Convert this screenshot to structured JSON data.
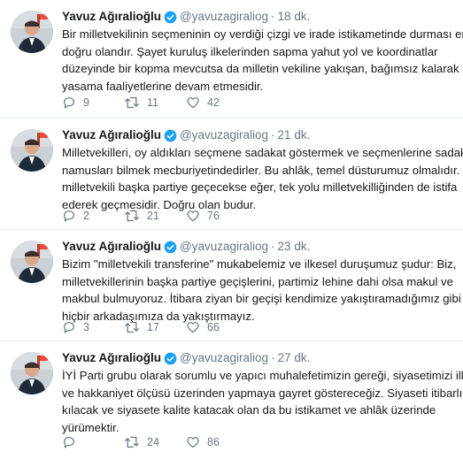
{
  "colors": {
    "accent": "#1da1f2",
    "muted": "#657786",
    "text": "#14171a",
    "divider": "#e6ecf0"
  },
  "icons": {
    "verified": "verified-badge-icon",
    "reply": "reply-icon",
    "retweet": "retweet-icon",
    "like": "heart-icon"
  },
  "tweets": [
    {
      "name": "Yavuz Ağıralioğlu",
      "handle": "@yavuzagiraliog",
      "dot": "·",
      "time": "18 dk.",
      "lines": [
        "Bir milletvekilinin seçmeninin oy verdiği çizgi ve irade istikametinde durması en",
        "doğru olandır. Şayet kuruluş ilkelerinden sapma yahut yol ve koordinatlar",
        "düzeyinde bir kopma mevcutsa da milletin vekiline yakışan, bağımsız kalarak",
        "yasama faaliyetlerine devam etmesidir."
      ],
      "replies": "9",
      "retweets": "11",
      "likes": "42"
    },
    {
      "name": "Yavuz Ağıralioğlu",
      "handle": "@yavuzagiraliog",
      "dot": "·",
      "time": "21 dk.",
      "lines": [
        "Milletvekilleri, oy aldıkları seçmene sadakat göstermek ve seçmenlerine sadakati",
        "namusları bilmek mecburiyetindedirler. Bu ahlâk, temel düsturumuz olmalıdır. Bir",
        "milletvekili başka partiye geçecekse eğer, tek yolu milletvekilliğinden de istifa",
        "ederek geçmesidir. Doğru olan budur."
      ],
      "replies": "2",
      "retweets": "21",
      "likes": "76"
    },
    {
      "name": "Yavuz Ağıralioğlu",
      "handle": "@yavuzagiraliog",
      "dot": "·",
      "time": "23 dk.",
      "lines": [
        "Bizim \"milletvekili transferine\" mukabelemiz ve ilkesel duruşumuz şudur: Biz,",
        "milletvekillerinin başka partiye geçişlerini, partimiz lehine dahi olsa makul ve",
        "makbul bulmuyoruz. İtibara ziyan bir geçişi kendimize yakıştıramadığımız gibi",
        "hiçbir arkadaşımıza da yakıştırmayız."
      ],
      "replies": "3",
      "retweets": "17",
      "likes": "66"
    },
    {
      "name": "Yavuz Ağıralioğlu",
      "handle": "@yavuzagiraliog",
      "dot": "·",
      "time": "27 dk.",
      "lines": [
        "İYİ Parti grubu olarak sorumlu ve yapıcı muhalefetimizin gereği, siyasetimizi ilkeler",
        "ve hakkaniyet ölçüsü üzerinden yapmaya gayret göstereceğiz. Siyaseti itibarlı",
        "kılacak ve siyasete kalite katacak olan da bu istikamet ve ahlâk üzerinde",
        "yürümektir."
      ],
      "replies": "",
      "retweets": "24",
      "likes": "86"
    }
  ]
}
